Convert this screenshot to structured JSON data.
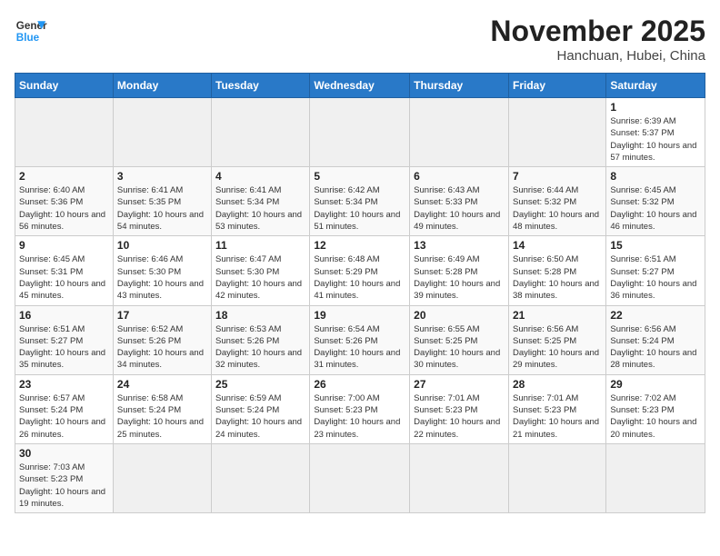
{
  "logo": {
    "line1": "General",
    "line2": "Blue"
  },
  "title": "November 2025",
  "location": "Hanchuan, Hubei, China",
  "headers": [
    "Sunday",
    "Monday",
    "Tuesday",
    "Wednesday",
    "Thursday",
    "Friday",
    "Saturday"
  ],
  "weeks": [
    [
      {
        "day": "",
        "info": ""
      },
      {
        "day": "",
        "info": ""
      },
      {
        "day": "",
        "info": ""
      },
      {
        "day": "",
        "info": ""
      },
      {
        "day": "",
        "info": ""
      },
      {
        "day": "",
        "info": ""
      },
      {
        "day": "1",
        "info": "Sunrise: 6:39 AM\nSunset: 5:37 PM\nDaylight: 10 hours and 57 minutes."
      }
    ],
    [
      {
        "day": "2",
        "info": "Sunrise: 6:40 AM\nSunset: 5:36 PM\nDaylight: 10 hours and 56 minutes."
      },
      {
        "day": "3",
        "info": "Sunrise: 6:41 AM\nSunset: 5:35 PM\nDaylight: 10 hours and 54 minutes."
      },
      {
        "day": "4",
        "info": "Sunrise: 6:41 AM\nSunset: 5:34 PM\nDaylight: 10 hours and 53 minutes."
      },
      {
        "day": "5",
        "info": "Sunrise: 6:42 AM\nSunset: 5:34 PM\nDaylight: 10 hours and 51 minutes."
      },
      {
        "day": "6",
        "info": "Sunrise: 6:43 AM\nSunset: 5:33 PM\nDaylight: 10 hours and 49 minutes."
      },
      {
        "day": "7",
        "info": "Sunrise: 6:44 AM\nSunset: 5:32 PM\nDaylight: 10 hours and 48 minutes."
      },
      {
        "day": "8",
        "info": "Sunrise: 6:45 AM\nSunset: 5:32 PM\nDaylight: 10 hours and 46 minutes."
      }
    ],
    [
      {
        "day": "9",
        "info": "Sunrise: 6:45 AM\nSunset: 5:31 PM\nDaylight: 10 hours and 45 minutes."
      },
      {
        "day": "10",
        "info": "Sunrise: 6:46 AM\nSunset: 5:30 PM\nDaylight: 10 hours and 43 minutes."
      },
      {
        "day": "11",
        "info": "Sunrise: 6:47 AM\nSunset: 5:30 PM\nDaylight: 10 hours and 42 minutes."
      },
      {
        "day": "12",
        "info": "Sunrise: 6:48 AM\nSunset: 5:29 PM\nDaylight: 10 hours and 41 minutes."
      },
      {
        "day": "13",
        "info": "Sunrise: 6:49 AM\nSunset: 5:28 PM\nDaylight: 10 hours and 39 minutes."
      },
      {
        "day": "14",
        "info": "Sunrise: 6:50 AM\nSunset: 5:28 PM\nDaylight: 10 hours and 38 minutes."
      },
      {
        "day": "15",
        "info": "Sunrise: 6:51 AM\nSunset: 5:27 PM\nDaylight: 10 hours and 36 minutes."
      }
    ],
    [
      {
        "day": "16",
        "info": "Sunrise: 6:51 AM\nSunset: 5:27 PM\nDaylight: 10 hours and 35 minutes."
      },
      {
        "day": "17",
        "info": "Sunrise: 6:52 AM\nSunset: 5:26 PM\nDaylight: 10 hours and 34 minutes."
      },
      {
        "day": "18",
        "info": "Sunrise: 6:53 AM\nSunset: 5:26 PM\nDaylight: 10 hours and 32 minutes."
      },
      {
        "day": "19",
        "info": "Sunrise: 6:54 AM\nSunset: 5:26 PM\nDaylight: 10 hours and 31 minutes."
      },
      {
        "day": "20",
        "info": "Sunrise: 6:55 AM\nSunset: 5:25 PM\nDaylight: 10 hours and 30 minutes."
      },
      {
        "day": "21",
        "info": "Sunrise: 6:56 AM\nSunset: 5:25 PM\nDaylight: 10 hours and 29 minutes."
      },
      {
        "day": "22",
        "info": "Sunrise: 6:56 AM\nSunset: 5:24 PM\nDaylight: 10 hours and 28 minutes."
      }
    ],
    [
      {
        "day": "23",
        "info": "Sunrise: 6:57 AM\nSunset: 5:24 PM\nDaylight: 10 hours and 26 minutes."
      },
      {
        "day": "24",
        "info": "Sunrise: 6:58 AM\nSunset: 5:24 PM\nDaylight: 10 hours and 25 minutes."
      },
      {
        "day": "25",
        "info": "Sunrise: 6:59 AM\nSunset: 5:24 PM\nDaylight: 10 hours and 24 minutes."
      },
      {
        "day": "26",
        "info": "Sunrise: 7:00 AM\nSunset: 5:23 PM\nDaylight: 10 hours and 23 minutes."
      },
      {
        "day": "27",
        "info": "Sunrise: 7:01 AM\nSunset: 5:23 PM\nDaylight: 10 hours and 22 minutes."
      },
      {
        "day": "28",
        "info": "Sunrise: 7:01 AM\nSunset: 5:23 PM\nDaylight: 10 hours and 21 minutes."
      },
      {
        "day": "29",
        "info": "Sunrise: 7:02 AM\nSunset: 5:23 PM\nDaylight: 10 hours and 20 minutes."
      }
    ],
    [
      {
        "day": "30",
        "info": "Sunrise: 7:03 AM\nSunset: 5:23 PM\nDaylight: 10 hours and 19 minutes."
      },
      {
        "day": "",
        "info": ""
      },
      {
        "day": "",
        "info": ""
      },
      {
        "day": "",
        "info": ""
      },
      {
        "day": "",
        "info": ""
      },
      {
        "day": "",
        "info": ""
      },
      {
        "day": "",
        "info": ""
      }
    ]
  ]
}
